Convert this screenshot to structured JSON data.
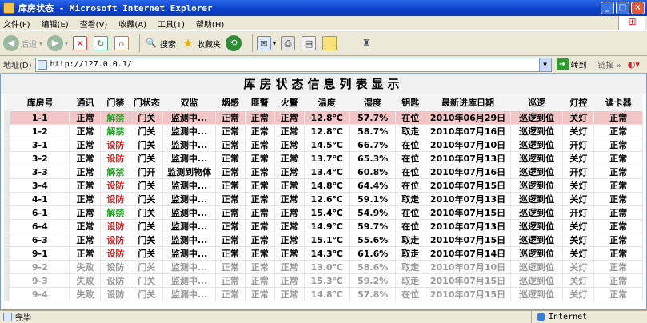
{
  "window": {
    "title": "库房状态 - Microsoft Internet Explorer"
  },
  "menu": [
    "文件(F)",
    "编辑(E)",
    "查看(V)",
    "收藏(A)",
    "工具(T)",
    "帮助(H)"
  ],
  "toolbar": {
    "back": "后退",
    "search": "搜索",
    "favorites": "收藏夹"
  },
  "address": {
    "label": "地址(D)",
    "url": "http://127.0.0.1/",
    "go": "转到",
    "links": "链接"
  },
  "page": {
    "title": "库房状态信息列表显示"
  },
  "table": {
    "headers": [
      "库房号",
      "通讯",
      "门禁",
      "门状态",
      "双监",
      "烟感",
      "匪警",
      "火警",
      "温度",
      "湿度",
      "钥匙",
      "最新进库日期",
      "巡逻",
      "灯控",
      "读卡器"
    ],
    "rows": [
      [
        "1-1",
        "正常",
        "解禁",
        "门关",
        "监测中...",
        "正常",
        "正常",
        "正常",
        "12.8℃",
        "57.7%",
        "在位",
        "2010年06月29日",
        "巡逻到位",
        "关灯",
        "正常"
      ],
      [
        "1-2",
        "正常",
        "解禁",
        "门关",
        "监测中...",
        "正常",
        "正常",
        "正常",
        "12.8℃",
        "58.7%",
        "取走",
        "2010年07月16日",
        "巡逻到位",
        "关灯",
        "正常"
      ],
      [
        "3-1",
        "正常",
        "设防",
        "门关",
        "监测中...",
        "正常",
        "正常",
        "正常",
        "14.5℃",
        "66.7%",
        "在位",
        "2010年07月10日",
        "巡逻到位",
        "开灯",
        "正常"
      ],
      [
        "3-2",
        "正常",
        "设防",
        "门关",
        "监测中...",
        "正常",
        "正常",
        "正常",
        "13.7℃",
        "65.3%",
        "在位",
        "2010年07月13日",
        "巡逻到位",
        "关灯",
        "正常"
      ],
      [
        "3-3",
        "正常",
        "解禁",
        "门开",
        "监测到物体",
        "正常",
        "正常",
        "正常",
        "13.4℃",
        "60.8%",
        "在位",
        "2010年07月16日",
        "巡逻到位",
        "开灯",
        "正常"
      ],
      [
        "3-4",
        "正常",
        "设防",
        "门关",
        "监测中...",
        "正常",
        "正常",
        "正常",
        "14.8℃",
        "64.4%",
        "在位",
        "2010年07月15日",
        "巡逻到位",
        "关灯",
        "正常"
      ],
      [
        "4-1",
        "正常",
        "设防",
        "门关",
        "监测中...",
        "正常",
        "正常",
        "正常",
        "12.6℃",
        "59.1%",
        "取走",
        "2010年07月13日",
        "巡逻到位",
        "关灯",
        "正常"
      ],
      [
        "6-1",
        "正常",
        "解禁",
        "门关",
        "监测中...",
        "正常",
        "正常",
        "正常",
        "15.4℃",
        "54.9%",
        "在位",
        "2010年07月15日",
        "巡逻到位",
        "开灯",
        "正常"
      ],
      [
        "6-4",
        "正常",
        "设防",
        "门关",
        "监测中...",
        "正常",
        "正常",
        "正常",
        "14.9℃",
        "59.7%",
        "在位",
        "2010年07月13日",
        "巡逻到位",
        "关灯",
        "正常"
      ],
      [
        "6-3",
        "正常",
        "设防",
        "门关",
        "监测中...",
        "正常",
        "正常",
        "正常",
        "15.1℃",
        "55.6%",
        "取走",
        "2010年07月15日",
        "巡逻到位",
        "关灯",
        "正常"
      ],
      [
        "9-1",
        "正常",
        "设防",
        "门关",
        "监测中...",
        "正常",
        "正常",
        "正常",
        "14.3℃",
        "61.6%",
        "取走",
        "2010年07月14日",
        "巡逻到位",
        "关灯",
        "正常"
      ],
      [
        "9-2",
        "失败",
        "设防",
        "门关",
        "监测中...",
        "正常",
        "正常",
        "正常",
        "13.0℃",
        "58.6%",
        "取走",
        "2010年07月10日",
        "巡逻到位",
        "关灯",
        "正常"
      ],
      [
        "9-3",
        "失败",
        "设防",
        "门关",
        "监测中...",
        "正常",
        "正常",
        "正常",
        "15.3℃",
        "59.2%",
        "取走",
        "2010年07月15日",
        "巡逻到位",
        "关灯",
        "正常"
      ],
      [
        "9-4",
        "失败",
        "设防",
        "门关",
        "监测中...",
        "正常",
        "正常",
        "正常",
        "14.8℃",
        "57.8%",
        "在位",
        "2010年07月15日",
        "巡逻到位",
        "关灯",
        "正常"
      ]
    ]
  },
  "status": {
    "left": "完毕",
    "zone": "Internet"
  }
}
